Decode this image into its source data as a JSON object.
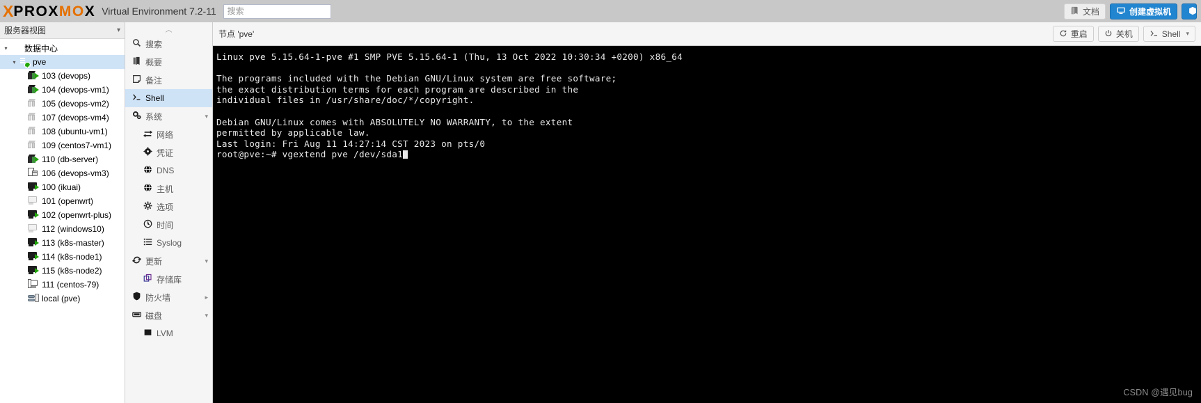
{
  "topbar": {
    "logo_x": "X",
    "logo_word_parts": [
      {
        "t": "PROX",
        "c": "black"
      },
      {
        "t": "MO",
        "c": "orange"
      },
      {
        "t": "X",
        "c": "black"
      }
    ],
    "product_name": "Virtual Environment 7.2-11",
    "search_placeholder": "搜索",
    "search_value": "",
    "docs_label": "文档",
    "create_vm_label": "创建虚拟机",
    "create_ct_label": ""
  },
  "tree": {
    "view_selector": "服务器视图",
    "datacenter": "数据中心",
    "node": "pve",
    "items": [
      {
        "label": "103 (devops)",
        "icon": "lxc-running"
      },
      {
        "label": "104 (devops-vm1)",
        "icon": "lxc-running"
      },
      {
        "label": "105 (devops-vm2)",
        "icon": "lxc-stopped"
      },
      {
        "label": "107 (devops-vm4)",
        "icon": "lxc-stopped"
      },
      {
        "label": "108 (ubuntu-vm1)",
        "icon": "lxc-stopped"
      },
      {
        "label": "109 (centos7-vm1)",
        "icon": "lxc-stopped"
      },
      {
        "label": "110 (db-server)",
        "icon": "lxc-running"
      },
      {
        "label": "106 (devops-vm3)",
        "icon": "lxc-template"
      },
      {
        "label": "100 (ikuai)",
        "icon": "qemu-running"
      },
      {
        "label": "101 (openwrt)",
        "icon": "qemu-stopped"
      },
      {
        "label": "102 (openwrt-plus)",
        "icon": "qemu-running"
      },
      {
        "label": "112 (windows10)",
        "icon": "qemu-stopped"
      },
      {
        "label": "113 (k8s-master)",
        "icon": "qemu-running"
      },
      {
        "label": "114 (k8s-node1)",
        "icon": "qemu-running"
      },
      {
        "label": "115 (k8s-node2)",
        "icon": "qemu-running"
      },
      {
        "label": "111 (centos-79)",
        "icon": "qemu-template"
      },
      {
        "label": "local (pve)",
        "icon": "storage"
      }
    ]
  },
  "nav": {
    "items": [
      {
        "label": "搜索",
        "icon": "search-icon",
        "indent": false,
        "selected": false,
        "expander": ""
      },
      {
        "label": "概要",
        "icon": "summary-icon",
        "indent": false,
        "selected": false,
        "expander": ""
      },
      {
        "label": "备注",
        "icon": "notes-icon",
        "indent": false,
        "selected": false,
        "expander": ""
      },
      {
        "label": "Shell",
        "icon": "shell-icon",
        "indent": false,
        "selected": true,
        "expander": ""
      },
      {
        "label": "系统",
        "icon": "system-icon",
        "indent": false,
        "selected": false,
        "expander": "▾"
      },
      {
        "label": "网络",
        "icon": "network-icon",
        "indent": true,
        "selected": false,
        "expander": ""
      },
      {
        "label": "凭证",
        "icon": "certificate-icon",
        "indent": true,
        "selected": false,
        "expander": ""
      },
      {
        "label": "DNS",
        "icon": "dns-icon",
        "indent": true,
        "selected": false,
        "expander": ""
      },
      {
        "label": "主机",
        "icon": "hosts-icon",
        "indent": true,
        "selected": false,
        "expander": ""
      },
      {
        "label": "选项",
        "icon": "options-icon",
        "indent": true,
        "selected": false,
        "expander": ""
      },
      {
        "label": "时间",
        "icon": "time-icon",
        "indent": true,
        "selected": false,
        "expander": ""
      },
      {
        "label": "Syslog",
        "icon": "syslog-icon",
        "indent": true,
        "selected": false,
        "expander": ""
      },
      {
        "label": "更新",
        "icon": "updates-icon",
        "indent": false,
        "selected": false,
        "expander": "▾"
      },
      {
        "label": "存储库",
        "icon": "repositories-icon",
        "indent": true,
        "selected": false,
        "expander": ""
      },
      {
        "label": "防火墙",
        "icon": "firewall-icon",
        "indent": false,
        "selected": false,
        "expander": "▸"
      },
      {
        "label": "磁盘",
        "icon": "disks-icon",
        "indent": false,
        "selected": false,
        "expander": "▾"
      },
      {
        "label": "LVM",
        "icon": "lvm-icon",
        "indent": true,
        "selected": false,
        "expander": ""
      }
    ]
  },
  "content_header": {
    "breadcrumb": "节点 'pve'",
    "restart_label": "重启",
    "shutdown_label": "关机",
    "shell_label": "Shell"
  },
  "terminal": {
    "lines": [
      "Linux pve 5.15.64-1-pve #1 SMP PVE 5.15.64-1 (Thu, 13 Oct 2022 10:30:34 +0200) x86_64",
      "",
      "The programs included with the Debian GNU/Linux system are free software;",
      "the exact distribution terms for each program are described in the",
      "individual files in /usr/share/doc/*/copyright.",
      "",
      "Debian GNU/Linux comes with ABSOLUTELY NO WARRANTY, to the extent",
      "permitted by applicable law.",
      "Last login: Fri Aug 11 14:27:14 CST 2023 on pts/0"
    ],
    "prompt": "root@pve:~# ",
    "command": "vgextend pve /dev/sda1",
    "watermark": "CSDN @遇见bug"
  }
}
